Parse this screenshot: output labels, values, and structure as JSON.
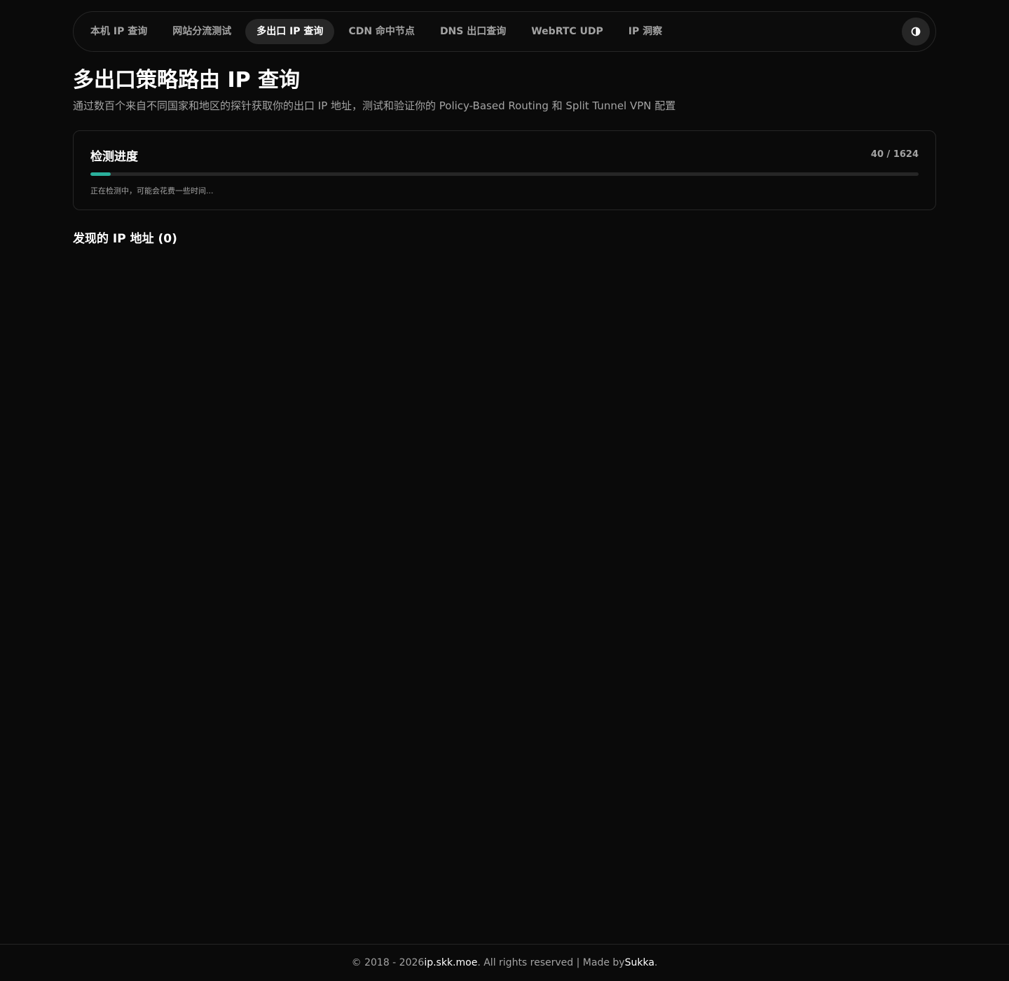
{
  "nav": {
    "tabs": [
      {
        "label": "本机 IP 查询"
      },
      {
        "label": "网站分流测试"
      },
      {
        "label": "多出口 IP 查询"
      },
      {
        "label": "CDN 命中节点"
      },
      {
        "label": "DNS 出口查询"
      },
      {
        "label": "WebRTC UDP"
      },
      {
        "label": "IP 洞察"
      }
    ],
    "active_index": 2,
    "theme_toggle_icon": "half-circle-icon"
  },
  "header": {
    "title": "多出口策略路由 IP 查询",
    "description": "通过数百个来自不同国家和地区的探针获取你的出口 IP 地址，测试和验证你的 Policy-Based Routing 和 Split Tunnel VPN 配置"
  },
  "progress": {
    "title": "检测进度",
    "count_text": "40 / 1624",
    "current": 40,
    "total": 1624,
    "status": "正在检测中，可能会花费一些时间...",
    "accent_color": "#2ab09c"
  },
  "results": {
    "title": "发现的 IP 地址 (0)"
  },
  "footer": {
    "prefix": "© 2018 - 2026 ",
    "site": "ip.skk.moe",
    "middle": ". All rights reserved | Made by ",
    "author": "Sukka",
    "suffix": "."
  }
}
